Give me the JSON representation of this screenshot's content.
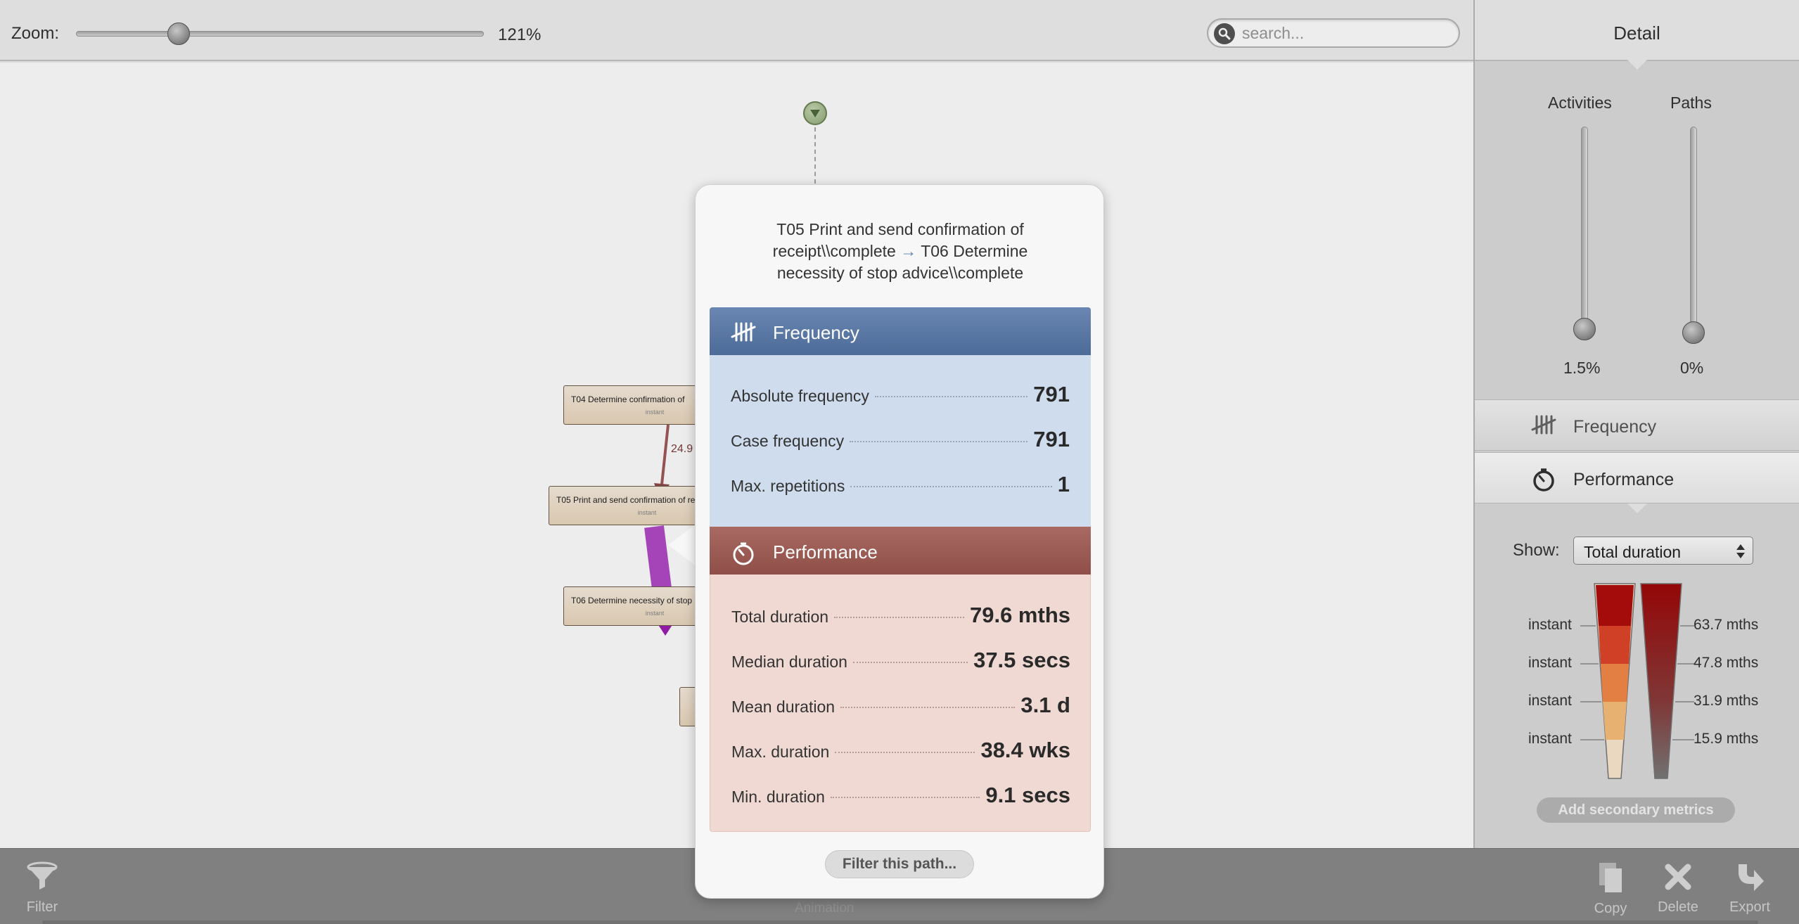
{
  "toolbar": {
    "zoom_label": "Zoom:",
    "zoom_value": "121%",
    "search_placeholder": "search..."
  },
  "canvas": {
    "activities": [
      {
        "title": "T04 Determine confirmation of",
        "sub": "instant"
      },
      {
        "title": "T05 Print and send confirmation of rec",
        "sub": "instant"
      },
      {
        "title": "T06 Determine necessity of stop",
        "sub": "instant"
      }
    ],
    "edge_label": "24.9"
  },
  "sidebar": {
    "header": "Detail",
    "activities_label": "Activities",
    "paths_label": "Paths",
    "activities_value": "1.5%",
    "paths_value": "0%",
    "frequency_tab": "Frequency",
    "performance_tab": "Performance",
    "show_label": "Show:",
    "show_value": "Total duration",
    "legend_left": [
      "instant",
      "instant",
      "instant",
      "instant"
    ],
    "legend_right": [
      "63.7 mths",
      "47.8 mths",
      "31.9 mths",
      "15.9 mths"
    ],
    "add_metrics": "Add secondary metrics",
    "colors": {
      "scale_left": [
        "#b10d0d",
        "#e0452b",
        "#f6894a",
        "#f9c07a",
        "#fde9cf"
      ],
      "scale_right_top": "#a00808",
      "scale_right_bottom": "#7a7a7a"
    }
  },
  "popup": {
    "title_line1": "T05 Print and send confirmation of",
    "title_line2_a": "receipt\\\\complete",
    "title_arrow": "→",
    "title_line2_b": "T06 Determine",
    "title_line3": "necessity of stop advice\\\\complete",
    "frequency": {
      "header": "Frequency",
      "metrics": [
        {
          "label": "Absolute frequency",
          "value": "791"
        },
        {
          "label": "Case frequency",
          "value": "791"
        },
        {
          "label": "Max. repetitions",
          "value": "1"
        }
      ]
    },
    "performance": {
      "header": "Performance",
      "metrics": [
        {
          "label": "Total duration",
          "value": "79.6 mths"
        },
        {
          "label": "Median duration",
          "value": "37.5 secs"
        },
        {
          "label": "Mean duration",
          "value": "3.1 d"
        },
        {
          "label": "Max. duration",
          "value": "38.4 wks"
        },
        {
          "label": "Min. duration",
          "value": "9.1 secs"
        }
      ]
    },
    "filter_button": "Filter this path..."
  },
  "bottombar": {
    "filter": "Filter",
    "animation": "Animation",
    "copy": "Copy",
    "delete": "Delete",
    "export": "Export"
  }
}
